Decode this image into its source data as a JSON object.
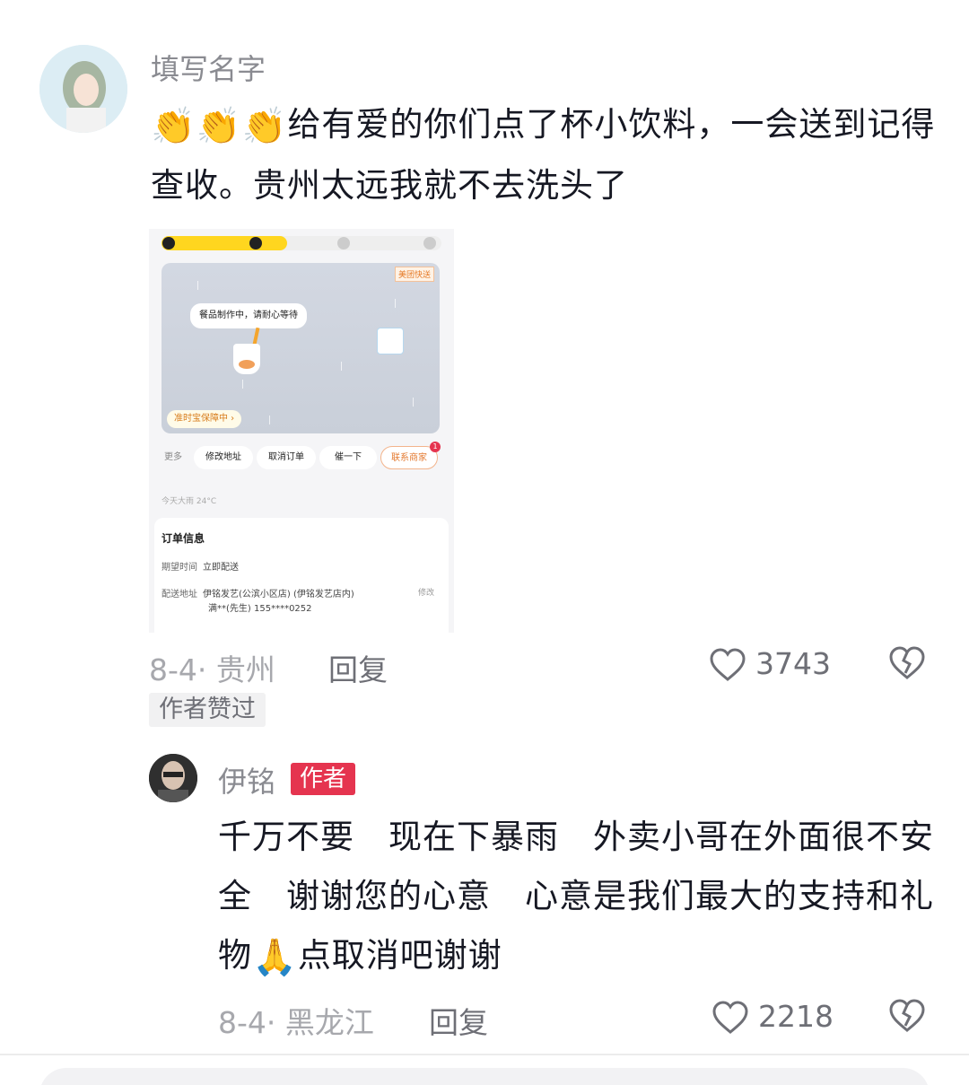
{
  "comment": {
    "username": "填写名字",
    "emojis": [
      "👏",
      "👏",
      "👏"
    ],
    "text": "给有爱的你们点了杯小饮料，一会送到记得查收。贵州太远我就不去洗头了",
    "meta": "8-4· 贵州",
    "reply_label": "回复",
    "likes": "3743",
    "liked_by_author": "作者赞过"
  },
  "order_screenshot": {
    "delivery_tag": "美团快送",
    "status_bubble": "餐品制作中，请耐心等待",
    "insurance": "准时宝保障中 ›",
    "actions": [
      "更多",
      "修改地址",
      "取消订单",
      "催一下",
      "联系商家"
    ],
    "contact_badge": "1",
    "weather": "今天大雨 24°C",
    "order_info_title": "订单信息",
    "expected_time_label": "期望时间",
    "expected_time_value": "立即配送",
    "address_label": "配送地址",
    "address_line1": "伊铭发艺(公滨小区店) (伊铭发艺店内)",
    "address_line2": "满**(先生) 155****0252",
    "edit_label": "修改"
  },
  "reply": {
    "username": "伊铭",
    "badge": "作者",
    "text_part1": "千万不要　现在下暴雨　外卖小哥在外面很不安全　谢谢您的心意　心意是我们最大的支持和礼物",
    "emoji": "🙏",
    "text_part2": "点取消吧谢谢",
    "meta": "8-4· 黑龙江",
    "reply_label": "回复",
    "likes": "2218"
  },
  "icons": {
    "like": "heart-outline-icon",
    "dislike": "broken-heart-icon"
  }
}
